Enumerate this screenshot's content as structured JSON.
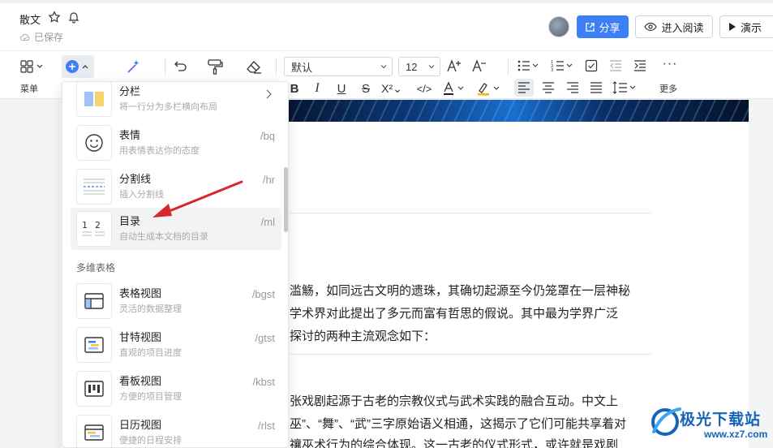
{
  "header": {
    "doc_title": "散文",
    "saved_status": "已保存",
    "share_label": "分享",
    "read_label": "进入阅读",
    "present_label": "演示"
  },
  "toolbar": {
    "menu_label": "菜单",
    "more_label": "更多",
    "font_family": "默认",
    "font_size": "12"
  },
  "insert_menu": {
    "items": [
      {
        "title": "分栏",
        "desc": "将一行分为多栏横向布局",
        "shortcut": "",
        "icon": "columns-icon"
      },
      {
        "title": "表情",
        "desc": "用表情表达你的态度",
        "shortcut": "/bq",
        "icon": "emoji-icon"
      },
      {
        "title": "分割线",
        "desc": "插入分割线",
        "shortcut": "/hr",
        "icon": "divider-icon"
      },
      {
        "title": "目录",
        "desc": "自动生成本文档的目录",
        "shortcut": "/ml",
        "icon": "toc-icon"
      }
    ],
    "section_label": "多维表格",
    "table_items": [
      {
        "title": "表格视图",
        "desc": "灵活的数据整理",
        "shortcut": "/bgst",
        "icon": "table-view-icon"
      },
      {
        "title": "甘特视图",
        "desc": "直观的项目进度",
        "shortcut": "/gtst",
        "icon": "gantt-view-icon"
      },
      {
        "title": "看板视图",
        "desc": "方便的项目管理",
        "shortcut": "/kbst",
        "icon": "kanban-view-icon"
      },
      {
        "title": "日历视图",
        "desc": "便捷的日程安排",
        "shortcut": "/rlst",
        "icon": "calendar-view-icon"
      }
    ]
  },
  "document": {
    "lines": [
      "滥觞，如同远古文明的遗珠，其确切起源至今仍笼罩在一层神秘",
      "学术界对此提出了多元而富有哲思的假说。其中最为学界广泛",
      "探讨的两种主流观念如下：",
      "张戏剧起源于古老的宗教仪式与武术实践的融合互动。中文上",
      "巫”、“舞”、“武”三字原始语义相通，这揭示了它们可能共享着对",
      "禳巫术行为的综合体现。这一古老的仪式形式，或许就是戏剧"
    ]
  },
  "watermark": {
    "name": "极光下载站",
    "url": "www.xz7.com"
  },
  "colors": {
    "accent": "#3d7ff5",
    "annotation_arrow": "#d9262c"
  }
}
